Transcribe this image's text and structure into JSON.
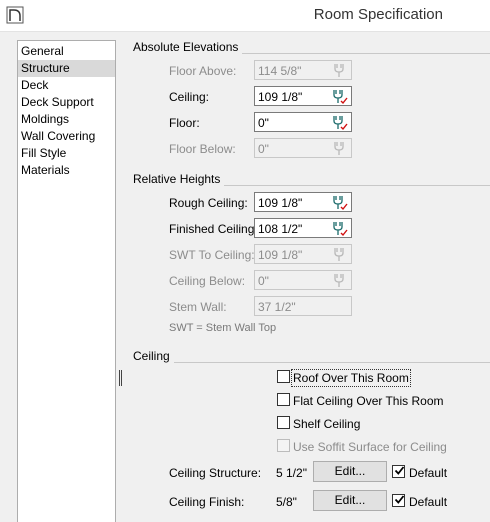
{
  "window": {
    "title": "Room Specification",
    "icon": "room-spec-icon"
  },
  "nav": {
    "items": [
      {
        "label": "General",
        "selected": false
      },
      {
        "label": "Structure",
        "selected": true
      },
      {
        "label": "Deck",
        "selected": false
      },
      {
        "label": "Deck Support",
        "selected": false
      },
      {
        "label": "Moldings",
        "selected": false
      },
      {
        "label": "Wall Covering",
        "selected": false
      },
      {
        "label": "Fill Style",
        "selected": false
      },
      {
        "label": "Materials",
        "selected": false
      }
    ]
  },
  "absolute_elevations": {
    "title": "Absolute Elevations",
    "floor_above": {
      "label": "Floor Above:",
      "value": "114 5/8\"",
      "enabled": false
    },
    "ceiling": {
      "label": "Ceiling:",
      "value": "109 1/8\"",
      "enabled": true
    },
    "floor": {
      "label": "Floor:",
      "value": "0\"",
      "enabled": true
    },
    "floor_below": {
      "label": "Floor Below:",
      "value": "0\"",
      "enabled": false
    }
  },
  "relative_heights": {
    "title": "Relative Heights",
    "rough_ceiling": {
      "label": "Rough Ceiling:",
      "value": "109 1/8\"",
      "enabled": true
    },
    "finished_ceiling": {
      "label": "Finished Ceiling:",
      "value": "108 1/2\"",
      "enabled": true
    },
    "swt_to_ceiling": {
      "label": "SWT To Ceiling:",
      "value": "109 1/8\"",
      "enabled": false
    },
    "ceiling_below": {
      "label": "Ceiling Below:",
      "value": "0\"",
      "enabled": false
    },
    "stem_wall": {
      "label": "Stem Wall:",
      "value": "37 1/2\"",
      "enabled": false
    },
    "note": "SWT = Stem Wall Top"
  },
  "ceiling": {
    "title": "Ceiling",
    "roof_over": {
      "label": "Roof Over This Room",
      "checked": false
    },
    "flat_ceiling": {
      "label": "Flat Ceiling Over This Room",
      "checked": false
    },
    "shelf_ceiling": {
      "label": "Shelf Ceiling",
      "checked": false
    },
    "soffit_surface": {
      "label": "Use Soffit Surface for Ceiling",
      "checked": false,
      "enabled": false
    },
    "structure": {
      "label": "Ceiling Structure:",
      "value": "5 1/2\"",
      "button": "Edit...",
      "default_label": "Default",
      "default_checked": true
    },
    "finish": {
      "label": "Ceiling Finish:",
      "value": "5/8\"",
      "button": "Edit...",
      "default_label": "Default",
      "default_checked": true
    }
  }
}
